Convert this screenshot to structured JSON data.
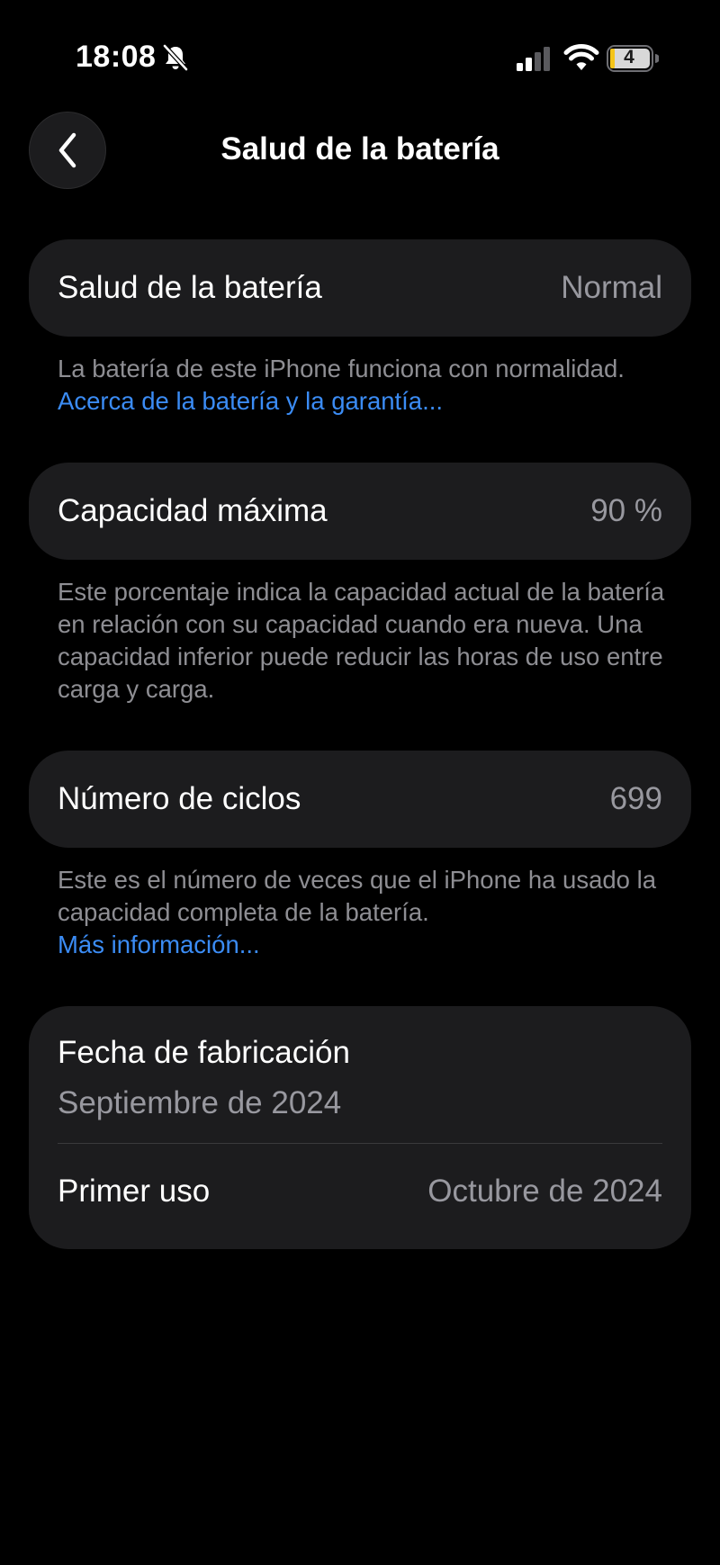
{
  "status_bar": {
    "time": "18:08",
    "battery_level": "4",
    "icons": [
      "bell-slash-icon",
      "cellular-signal-icon",
      "wifi-icon",
      "battery-icon"
    ]
  },
  "nav": {
    "back_icon": "chevron-left-icon",
    "title": "Salud de la batería"
  },
  "health": {
    "label": "Salud de la batería",
    "value": "Normal",
    "footnote_text": "La batería de este iPhone funciona con normalidad. ",
    "footnote_link": "Acerca de la batería y la garantía..."
  },
  "capacity": {
    "label": "Capacidad máxima",
    "value": "90 %",
    "footnote_text": "Este porcentaje indica la capacidad actual de la batería en relación con su capacidad cuando era nueva. Una capacidad inferior puede reducir las horas de uso entre carga y carga."
  },
  "cycles": {
    "label": "Número de ciclos",
    "value": "699",
    "footnote_text": "Este es el número de veces que el iPhone ha usado la capacidad completa de la batería.",
    "footnote_link": "Más información..."
  },
  "dates": {
    "manufacture_label": "Fecha de fabricación",
    "manufacture_value": "Septiembre de 2024",
    "first_use_label": "Primer uso",
    "first_use_value": "Octubre de 2024"
  },
  "colors": {
    "background": "#000000",
    "card": "#1c1c1e",
    "secondary_text": "#8e8e93",
    "link": "#3b8cf5"
  }
}
